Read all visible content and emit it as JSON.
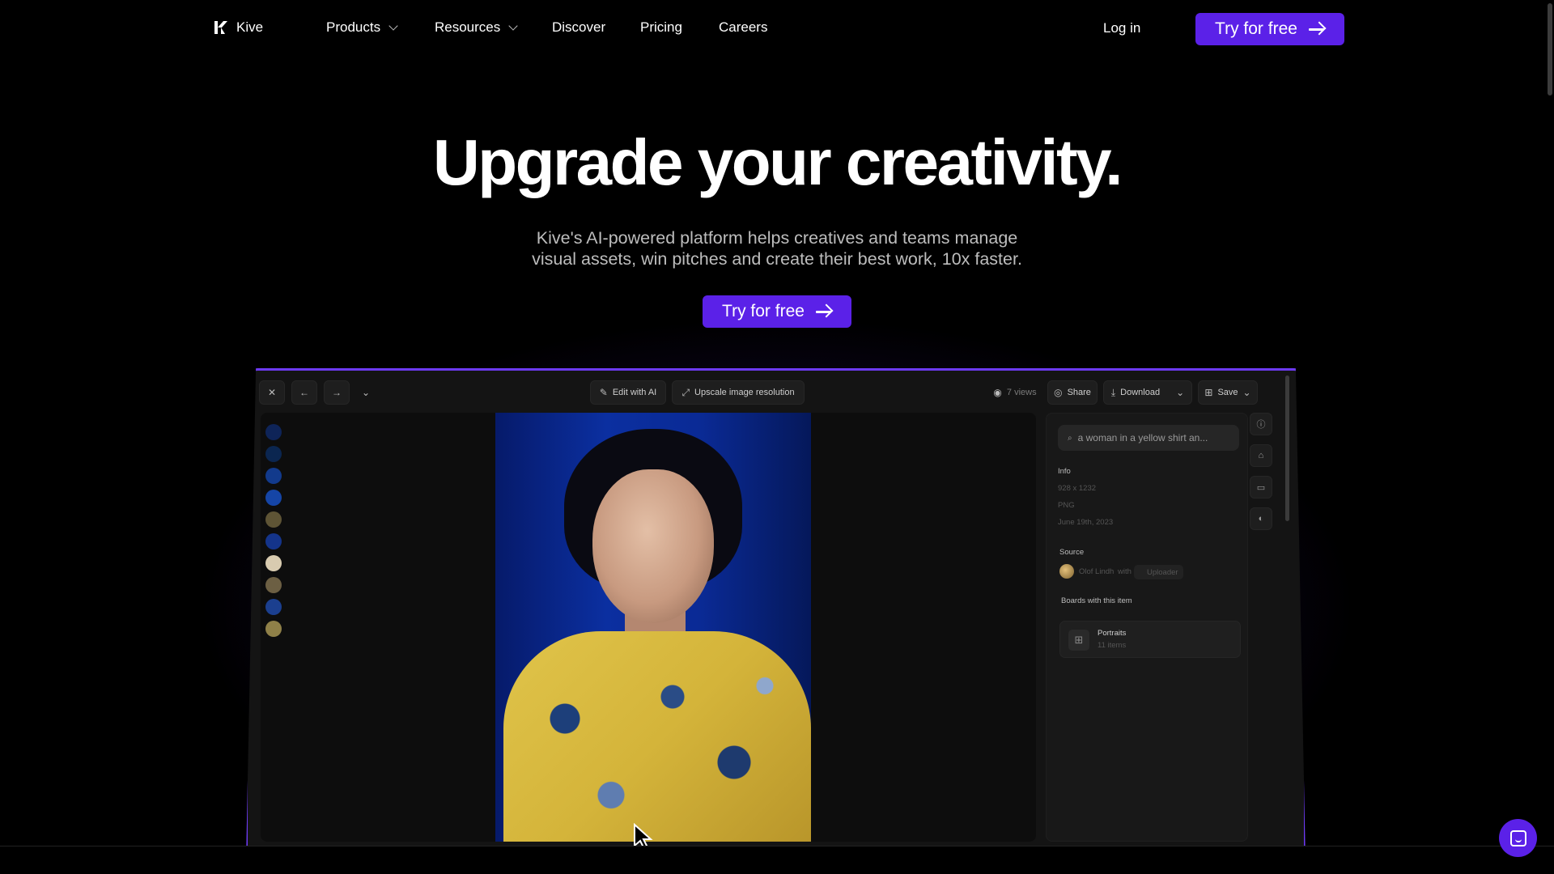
{
  "nav": {
    "brand": "Kive",
    "links": [
      {
        "label": "Products",
        "has_dropdown": true
      },
      {
        "label": "Resources",
        "has_dropdown": true
      },
      {
        "label": "Discover",
        "has_dropdown": false
      },
      {
        "label": "Pricing",
        "has_dropdown": false
      },
      {
        "label": "Careers",
        "has_dropdown": false
      }
    ],
    "login": "Log in",
    "cta": "Try for free"
  },
  "hero": {
    "title": "Upgrade your creativity.",
    "subtitle_line1": "Kive's AI-powered platform helps creatives and teams manage",
    "subtitle_line2": "visual assets, win pitches and create their best work, 10x faster.",
    "cta": "Try for free"
  },
  "app": {
    "toolbar": {
      "edit_ai": "Edit with AI",
      "upscale": "Upscale image resolution",
      "views": "7 views",
      "share": "Share",
      "download": "Download",
      "save": "Save"
    },
    "palette": [
      "#0e2458",
      "#0b2650",
      "#123a8c",
      "#1545a6",
      "#5e5435",
      "#14348a",
      "#d8cbb0",
      "#6c5f43",
      "#1b3f8f",
      "#8f8048"
    ],
    "panel": {
      "search_text": "a woman in a yellow shirt an...",
      "info_label": "Info",
      "dimensions": "928 x 1232",
      "format": "PNG",
      "date": "June 19th, 2023",
      "source_label": "Source",
      "source_author": "Olof Lindh",
      "source_with": "with",
      "source_tool": "Uploader",
      "boards_label": "Boards with this item",
      "board_name": "Portraits",
      "board_count": "11 items"
    }
  },
  "colors": {
    "accent": "#5b21e8",
    "background": "#000000"
  }
}
